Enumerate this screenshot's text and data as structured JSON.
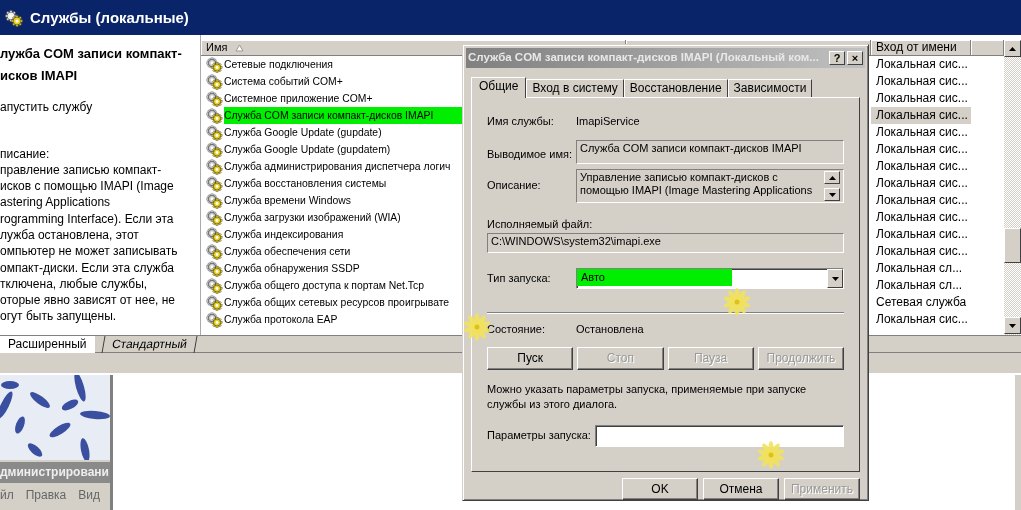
{
  "window": {
    "title": "Службы (локальные)"
  },
  "description_pane": {
    "title_lines": [
      "лужба COM записи компакт-",
      "исков IMAPI"
    ],
    "action_link": "апустить",
    "action_text": "службу",
    "description_label": "писание:",
    "description_lines": [
      "правление записью компакт-",
      "исков с помощью IMAPI (Image",
      "astering Applications",
      "rogramming Interface). Если эта",
      "лужба остановлена, этот",
      "омпьютер не может записывать",
      "омпакт-диски. Если эта служба",
      "тключена, любые службы,",
      "оторые явно зависят от нее, не",
      "огут быть запущены."
    ]
  },
  "services": {
    "name_column": {
      "label": "Имя",
      "sorted": true
    },
    "logon_column": {
      "label": "Вход от имени"
    },
    "rows": [
      {
        "name": "Сетевые подключения",
        "logon": "Локальная сис...",
        "selected": false
      },
      {
        "name": "Система событий COM+",
        "logon": "Локальная сис...",
        "selected": false
      },
      {
        "name": "Системное приложение COM+",
        "logon": "Локальная сис...",
        "selected": false
      },
      {
        "name": "Служба COM записи компакт-дисков IMAPI",
        "logon": "Локальная сис...",
        "selected": true
      },
      {
        "name": "Служба Google Update (gupdate)",
        "logon": "Локальная сис...",
        "selected": false
      },
      {
        "name": "Служба Google Update (gupdatem)",
        "logon": "Локальная сис...",
        "selected": false
      },
      {
        "name": "Служба администрирования диспетчера логич",
        "logon": "Локальная сис...",
        "selected": false
      },
      {
        "name": "Служба восстановления системы",
        "logon": "Локальная сис...",
        "selected": false
      },
      {
        "name": "Служба времени Windows",
        "logon": "Локальная сис...",
        "selected": false
      },
      {
        "name": "Служба загрузки изображений (WIA)",
        "logon": "Локальная сис...",
        "selected": false
      },
      {
        "name": "Служба индексирования",
        "logon": "Локальная сис...",
        "selected": false
      },
      {
        "name": "Служба обеспечения сети",
        "logon": "Локальная сис...",
        "selected": false
      },
      {
        "name": "Служба обнаружения SSDP",
        "logon": "Локальная сл...",
        "selected": false
      },
      {
        "name": "Служба общего доступа к портам Net.Tcp",
        "logon": "Локальная сл...",
        "selected": false
      },
      {
        "name": "Служба общих сетевых ресурсов проигрывате",
        "logon": "Сетевая служба",
        "selected": false
      },
      {
        "name": "Служба протокола EAP",
        "logon": "Локальная сис...",
        "selected": false
      }
    ]
  },
  "view_tabs": [
    {
      "label": "Расширенный",
      "selected": true
    },
    {
      "label": "Стандартный",
      "selected": false
    }
  ],
  "admin_panel": {
    "title": "дминистрировани",
    "menu": [
      "йл",
      "Правка",
      "Вид"
    ]
  },
  "dialog": {
    "title": "Служба COM записи компакт-дисков IMAPI (Локальный ком...",
    "help_button": "?",
    "close_button": "×",
    "tabs": [
      {
        "label": "Общие",
        "selected": true
      },
      {
        "label": "Вход в систему",
        "selected": false
      },
      {
        "label": "Восстановление",
        "selected": false
      },
      {
        "label": "Зависимости",
        "selected": false
      }
    ],
    "service_name_label": "Имя службы:",
    "service_name": "ImapiService",
    "display_name_label": "Выводимое имя:",
    "display_name": "Служба COM записи компакт-дисков IMAPI",
    "description_label": "Описание:",
    "description_lines": [
      "Управление записью компакт-дисков с",
      "помощью IMAPI (Image Mastering Applications"
    ],
    "executable_label": "Исполняемый файл:",
    "executable": "C:\\WINDOWS\\system32\\imapi.exe",
    "startup_type_label": "Тип запуска:",
    "startup_type": "Авто",
    "startup_type_highlighted": true,
    "status_label": "Состояние:",
    "status": "Остановлена",
    "service_buttons": [
      {
        "label": "Пуск",
        "disabled": false
      },
      {
        "label": "Стоп",
        "disabled": true
      },
      {
        "label": "Пауза",
        "disabled": true
      },
      {
        "label": "Продолжить",
        "disabled": true
      }
    ],
    "note_lines": [
      "Можно указать параметры запуска, применяемые при запуске",
      "службы из этого диалога."
    ],
    "parameters_label": "Параметры запуска:",
    "buttons": [
      {
        "label": "OK",
        "disabled": false
      },
      {
        "label": "Отмена",
        "disabled": false
      },
      {
        "label": "Применить",
        "disabled": true
      }
    ]
  }
}
